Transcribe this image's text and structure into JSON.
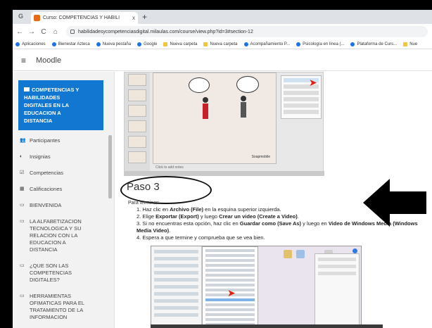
{
  "browser": {
    "tab_title": "Curso: COMPETENCIAS Y HABILI",
    "tab_close": "x",
    "new_tab": "+",
    "g_icon": "G",
    "url": "habilidadesycompetenciasdigital.milaulas.com/course/view.php?id=3#section-12",
    "nav": {
      "back": "←",
      "forward": "→",
      "reload": "C",
      "home": "⌂"
    }
  },
  "bookmarks": [
    {
      "label": "Aplicaciones",
      "icon": "grid-icon"
    },
    {
      "label": "Bienestar Azteca",
      "icon": "globe-icon"
    },
    {
      "label": "Nueva pestaña",
      "icon": "globe-icon"
    },
    {
      "label": "Google",
      "icon": "google-icon"
    },
    {
      "label": "Nueva carpeta",
      "icon": "folder-icon"
    },
    {
      "label": "Nueva carpeta",
      "icon": "folder-icon"
    },
    {
      "label": "Acompañamiento P...",
      "icon": "globe-icon"
    },
    {
      "label": "Psicología en línea (...",
      "icon": "globe-icon"
    },
    {
      "label": "Plataforma de Curs...",
      "icon": "globe-icon"
    },
    {
      "label": "Nue",
      "icon": "folder-icon"
    }
  ],
  "moodle": {
    "menu_icon": "≡",
    "title": "Moodle"
  },
  "sidebar": {
    "course_lines": [
      "COMPETENCIAS Y",
      "HABILIDADES",
      "DIGITALES EN LA",
      "EDUCACION A",
      "DISTANCIA"
    ],
    "items": [
      {
        "icon": "👥",
        "lines": [
          "Participantes"
        ]
      },
      {
        "icon": "◐",
        "lines": [
          "Insignias"
        ]
      },
      {
        "icon": "☑",
        "lines": [
          "Competencias"
        ]
      },
      {
        "icon": "▦",
        "lines": [
          "Calificaciones"
        ]
      },
      {
        "icon": "▭",
        "lines": [
          "BIENVENIDA"
        ]
      },
      {
        "icon": "▭",
        "lines": [
          "LA ALFABETIZACION",
          "TECNOLOGICA Y SU",
          "RELACION CON LA",
          "EDUCACION A",
          "DISTANCIA"
        ]
      },
      {
        "icon": "▭",
        "lines": [
          "¿QUE SON LAS",
          "COMPETENCIAS",
          "DIGITALES?"
        ]
      },
      {
        "icon": "▭",
        "lines": [
          "HERRAMIENTAS",
          "OFIMATICAS PARA EL",
          "TRATAMIENTO DE LA",
          "INFORMACION"
        ]
      }
    ]
  },
  "content": {
    "screenshot1": {
      "notes": "Click to add notes",
      "slide_label": "Soapmobile"
    },
    "paso_title": "Paso 3",
    "intro": "Para terminar:",
    "steps": [
      {
        "n": "1.",
        "pre": "Haz clic en ",
        "b1": "Archivo (File)",
        "mid": " en la esquina superior izquierda.",
        "b2": "",
        "mid2": "",
        "b3": "",
        "post": ""
      },
      {
        "n": "2.",
        "pre": "Elige ",
        "b1": "Exportar (Export)",
        "mid": " y luego ",
        "b2": "Crear un video (Create a Video)",
        "mid2": ".",
        "b3": "",
        "post": ""
      },
      {
        "n": "3.",
        "pre": "Si no encuentras esta opción, haz clic en ",
        "b1": "Guardar como (Save As)",
        "mid": " y luego en ",
        "b2": "Video de Windows Media (Windows Media Video)",
        "mid2": ".",
        "b3": "",
        "post": ""
      },
      {
        "n": "4.",
        "pre": "Espera a que termine y comprueba que se vea bien.",
        "b1": "",
        "mid": "",
        "b2": "",
        "mid2": "",
        "b3": "",
        "post": ""
      }
    ]
  },
  "colors": {
    "course_box": "#1177d1",
    "arrow": "#000000",
    "cursor": "#dd2211"
  }
}
